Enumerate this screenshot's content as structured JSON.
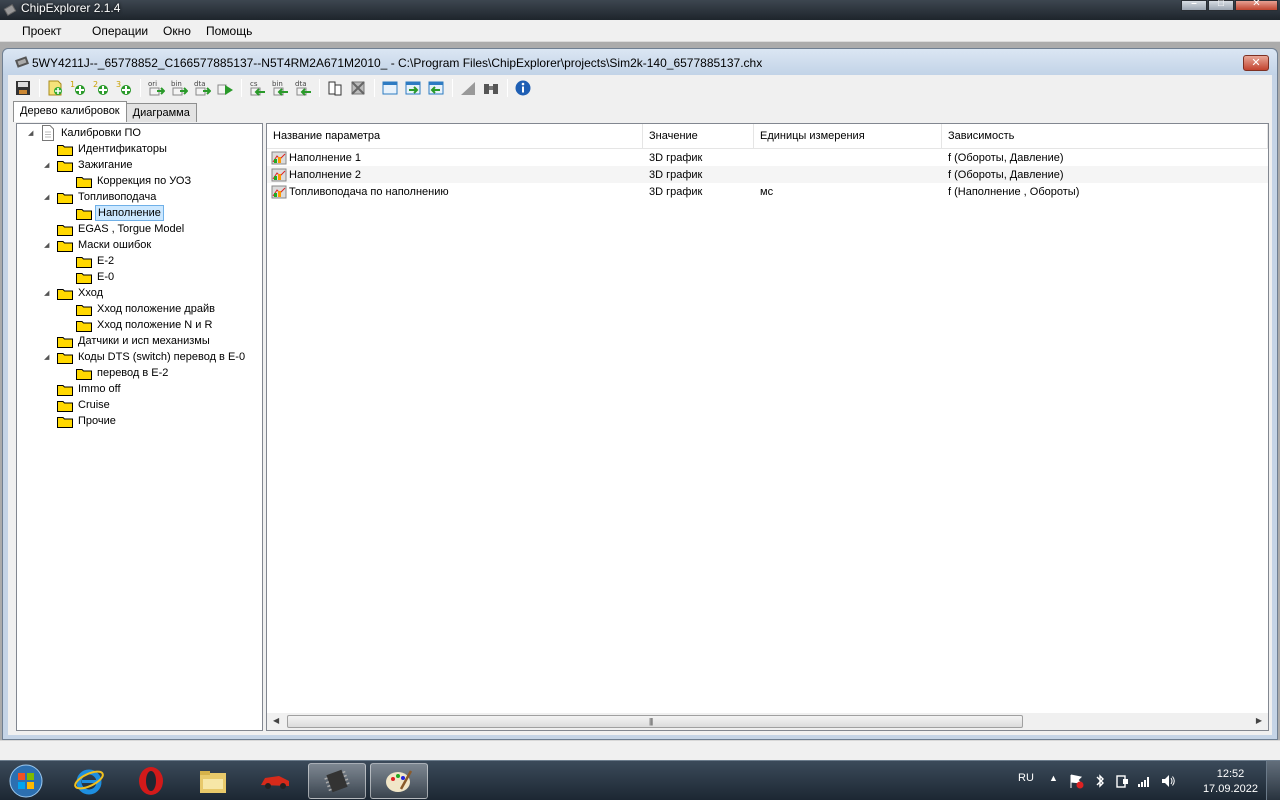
{
  "app": {
    "title": "ChipExplorer 2.1.4"
  },
  "menu": [
    "Проект",
    "Операции",
    "Окно",
    "Помощь"
  ],
  "child": {
    "title": "5WY4211J--_65778852_C166577885137--N5T4RM2A671M2010_ - C:\\Program Files\\ChipExplorer\\projects\\Sim2k-140_6577885137.chx",
    "close": "✕"
  },
  "toolbar": {
    "buttons": [
      "save-icon",
      "new-icon",
      "add-1-icon",
      "add-2-icon",
      "add-3-icon",
      "export-ori-icon",
      "export-bin-icon",
      "export-dta-icon",
      "run-icon",
      "checksum-icon",
      "import-bin-icon",
      "import-dta-icon",
      "copy-map-icon",
      "delete-map-icon",
      "window-icon",
      "window-in-icon",
      "window-out-icon",
      "triangle-icon",
      "binoculars-icon",
      "info-icon"
    ],
    "labels": {
      "ori": "ori",
      "bin": "bin",
      "dta": "dta",
      "cs": "cs",
      "n1": "1",
      "n2": "2",
      "n3": "3"
    }
  },
  "tabs": [
    "Дерево калибровок",
    "Диаграмма"
  ],
  "tree": {
    "root": "Калибровки ПО",
    "nodes": [
      {
        "label": "Идентификаторы"
      },
      {
        "label": "Зажигание"
      },
      {
        "label": "Коррекция по УОЗ"
      },
      {
        "label": "Топливоподача"
      },
      {
        "label": "Наполнение"
      },
      {
        "label": "EGAS , Torgue Model"
      },
      {
        "label": "Маски ошибок"
      },
      {
        "label": "E-2"
      },
      {
        "label": "E-0"
      },
      {
        "label": "Xход"
      },
      {
        "label": "Xход положение драйв"
      },
      {
        "label": "Xход положение N и R"
      },
      {
        "label": "Датчики и исп механизмы"
      },
      {
        "label": "Коды DTS (switch) перевод в E-0"
      },
      {
        "label": "перевод в E-2"
      },
      {
        "label": "Immo off"
      },
      {
        "label": "Cruise"
      },
      {
        "label": "Прочие"
      }
    ]
  },
  "list": {
    "columns": [
      "Название параметра",
      "Значение",
      "Единицы измерения",
      "Зависимость"
    ],
    "rows": [
      [
        "Наполнение 1",
        "3D график",
        "",
        "f (Обороты, Давление)"
      ],
      [
        "Наполнение 2",
        "3D график",
        "",
        "f (Обороты, Давление)"
      ],
      [
        "Топливоподача по наполнению",
        "3D график",
        "мс",
        "f (Наполнение , Обороты)"
      ]
    ]
  },
  "taskbar": {
    "apps": [
      "ie-icon",
      "opera-icon",
      "explorer-icon",
      "car-icon",
      "chip-icon",
      "paint-icon"
    ],
    "lang": "RU",
    "time": "12:52",
    "date": "17.09.2022"
  }
}
